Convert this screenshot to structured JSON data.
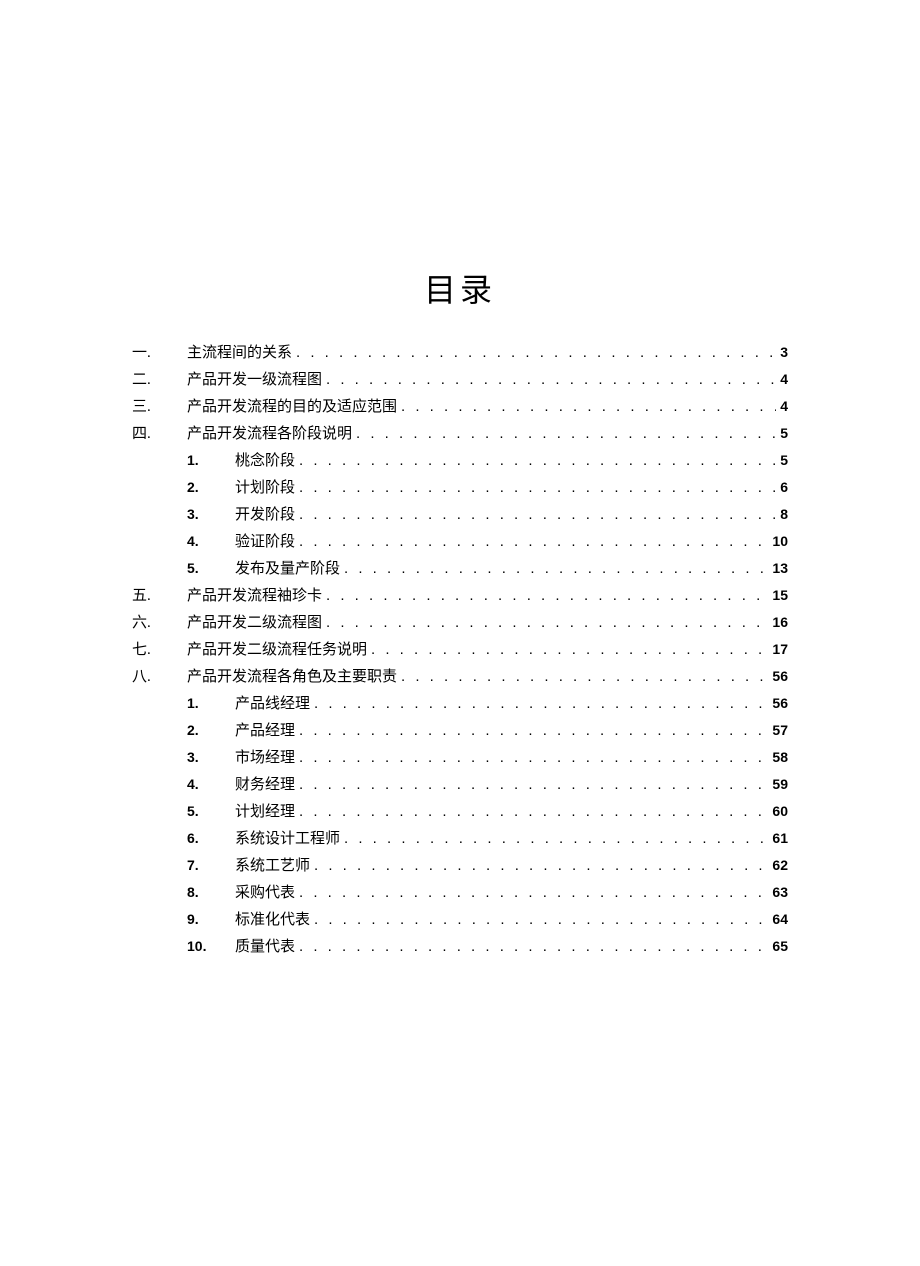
{
  "title": "目录",
  "entries": [
    {
      "mark": "一.",
      "text": "主流程间的关系",
      "page": "3",
      "level": 1
    },
    {
      "mark": "二.",
      "text": "产品开发一级流程图",
      "page": "4",
      "level": 1
    },
    {
      "mark": "三.",
      "text": "产品开发流程的目的及适应范围",
      "page": "4",
      "level": 1
    },
    {
      "mark": "四.",
      "text": "产品开发流程各阶段说明",
      "page": "5",
      "level": 1
    },
    {
      "mark": "1.",
      "text": "桃念阶段",
      "page": "5",
      "level": 2
    },
    {
      "mark": "2.",
      "text": "计划阶段",
      "page": "6",
      "level": 2
    },
    {
      "mark": "3.",
      "text": "开发阶段",
      "page": "8",
      "level": 2
    },
    {
      "mark": "4.",
      "text": "验证阶段",
      "page": "10",
      "level": 2
    },
    {
      "mark": "5.",
      "text": "发布及量产阶段",
      "page": "13",
      "level": 2
    },
    {
      "mark": "五.",
      "text": "产品开发流程袖珍卡",
      "page": "15",
      "level": 1
    },
    {
      "mark": "六.",
      "text": "产品开发二级流程图",
      "page": "16",
      "level": 1
    },
    {
      "mark": "七.",
      "text": "产品开发二级流程任务说明",
      "page": "17",
      "level": 1
    },
    {
      "mark": "八.",
      "text": "产品开发流程各角色及主要职责",
      "page": "56",
      "level": 1
    },
    {
      "mark": "1.",
      "text": "产品线经理",
      "page": "56",
      "level": 2
    },
    {
      "mark": "2.",
      "text": "产品经理",
      "page": "57",
      "level": 2
    },
    {
      "mark": "3.",
      "text": "市场经理",
      "page": "58",
      "level": 2
    },
    {
      "mark": "4.",
      "text": "财务经理",
      "page": "59",
      "level": 2
    },
    {
      "mark": "5.",
      "text": "计划经理",
      "page": "60",
      "level": 2
    },
    {
      "mark": "6.",
      "text": "系统设计工程师",
      "page": "61",
      "level": 2
    },
    {
      "mark": "7.",
      "text": "系统工艺师",
      "page": "62",
      "level": 2
    },
    {
      "mark": "8.",
      "text": "采购代表",
      "page": "63",
      "level": 2
    },
    {
      "mark": "9.",
      "text": "标准化代表",
      "page": "64",
      "level": 2
    },
    {
      "mark": "10.",
      "text": "质量代表",
      "page": "65",
      "level": 2
    }
  ]
}
